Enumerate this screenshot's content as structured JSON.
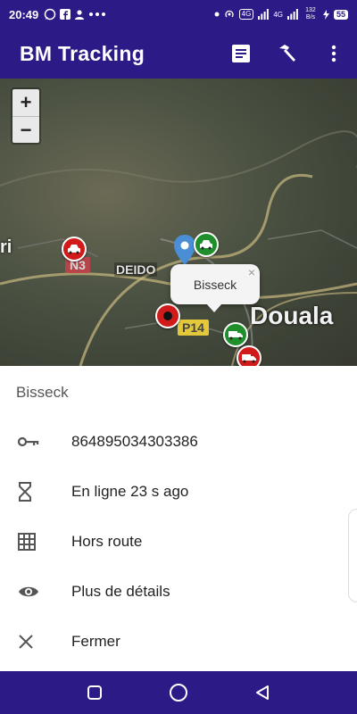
{
  "status_bar": {
    "time": "20:49",
    "net_a": "4G",
    "net_b": "4G",
    "speed": "132 B/s",
    "battery": "55"
  },
  "app_bar": {
    "title": "BM Tracking",
    "actions": [
      "list-icon",
      "hammer-icon",
      "more-vert-icon"
    ]
  },
  "map": {
    "zoom_in": "+",
    "zoom_out": "−",
    "labels": {
      "left": "ri",
      "deido": "DEIDO",
      "douala": "Douala"
    },
    "shields": {
      "n3": "N3",
      "p14": "P14"
    },
    "popup": {
      "title": "Bisseck",
      "close": "×"
    },
    "marker_colors": {
      "red": "#d11a1a",
      "green": "#1e8f2a"
    }
  },
  "sheet": {
    "title": "Bisseck",
    "items": [
      {
        "icon": "key-icon",
        "label": "864895034303386"
      },
      {
        "icon": "hourglass-icon",
        "label": "En ligne 23 s ago"
      },
      {
        "icon": "grid-icon",
        "label": "Hors route"
      },
      {
        "icon": "eye-icon",
        "label": "Plus de détails"
      },
      {
        "icon": "close-icon",
        "label": "Fermer"
      }
    ]
  },
  "nav_bar": {
    "buttons": [
      "recents-icon",
      "home-icon",
      "back-icon"
    ]
  },
  "colors": {
    "primary": "#2c1a86"
  }
}
